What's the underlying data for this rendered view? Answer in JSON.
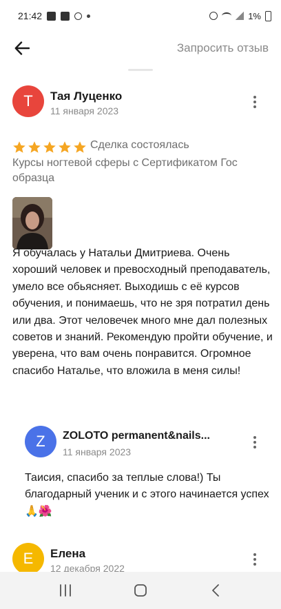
{
  "status_bar": {
    "time": "21:42",
    "battery": "1%"
  },
  "header": {
    "request_review_label": "Запросить отзыв"
  },
  "reviews": [
    {
      "avatar_letter": "Т",
      "avatar_color": "#e8453c",
      "author": "Тая Луценко",
      "date": "11 января 2023",
      "rating": 5,
      "deal_status": "Сделка состоялась",
      "course": "Курсы ногтевой сферы с Сертификатом Гос образца",
      "text": "Я обучалась у Натальи Дмитриева. Очень хороший человек и превосходный преподаватель,  умело все обьясняет. Выходишь с её курсов обучения, и понимаешь, что не зря потратил день или два. Этот человечек  много мне дал полезных советов и знаний.   Рекомендую пройти обучение, и уверена, что вам очень понравится.  Огромное спасибо Наталье, что вложила в меня силы!",
      "reply": {
        "avatar_letter": "Z",
        "avatar_color": "#4a72e8",
        "author": "ZOLOTO permanent&nails...",
        "date": "11 января 2023",
        "text": "Таисия, спасибо за теплые слова!) Ты благодарный ученик и с этого начинается успех🙏🌺"
      }
    },
    {
      "avatar_letter": "Е",
      "avatar_color": "#f5b800",
      "author": "Елена",
      "date": "12 декабря 2022"
    }
  ],
  "colors": {
    "star": "#f5a623",
    "muted_text": "#8a8a8a"
  },
  "icons": {
    "back": "arrow-left-icon",
    "more": "kebab-menu-icon",
    "nav_recents": "recents-icon",
    "nav_home": "home-icon",
    "nav_back": "nav-back-icon"
  }
}
